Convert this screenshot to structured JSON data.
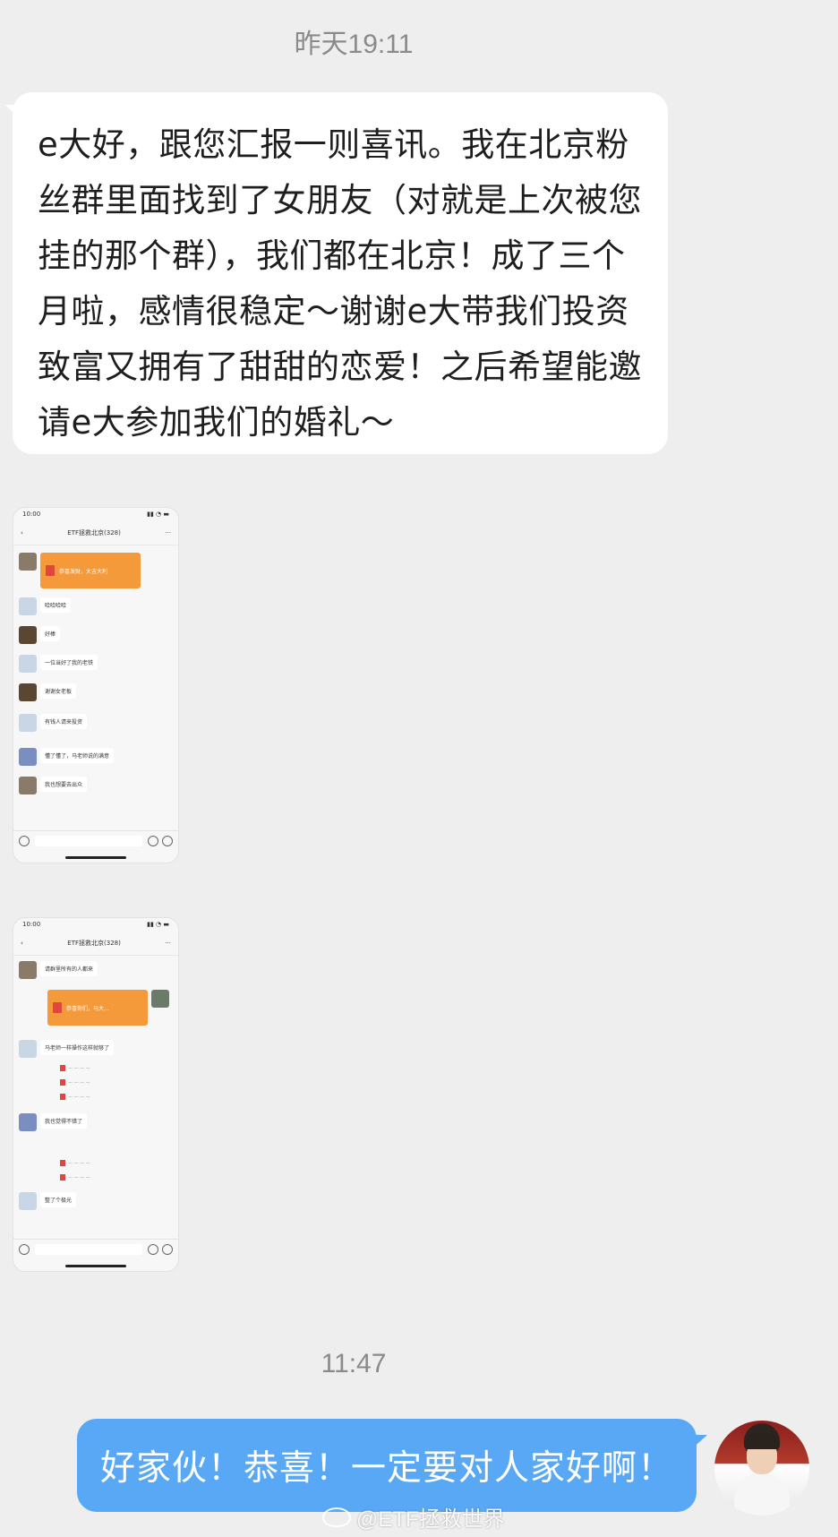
{
  "chat": {
    "timestamp_1": "昨天19:11",
    "incoming_message": "e大好，跟您汇报一则喜讯。我在北京粉丝群里面找到了女朋友（对就是上次被您挂的那个群），我们都在北京！成了三个月啦，感情很稳定～谢谢e大带我们投资致富又拥有了甜甜的恋爱！之后希望能邀请e大参加我们的婚礼～",
    "timestamp_2": "11:47",
    "outgoing_message": "好家伙！恭喜！一定要对人家好啊！"
  },
  "screenshot_1": {
    "status_time": "10:00",
    "group_title": "ETF拯救北京(328)",
    "messages": [
      {
        "type": "red_packet",
        "label": "恭喜发财，大吉大利"
      },
      {
        "type": "text",
        "text": "哈哈哈哈"
      },
      {
        "type": "text",
        "text": "好棒"
      },
      {
        "type": "text",
        "text": "一位当好了我的老铁"
      },
      {
        "type": "text",
        "text": "谢谢女老板"
      },
      {
        "type": "text",
        "text": "有钱人请来投资"
      },
      {
        "type": "text",
        "text": "懂了懂了，马老师说的满意"
      },
      {
        "type": "text",
        "text": "我也想要去出众"
      }
    ]
  },
  "screenshot_2": {
    "status_time": "10:00",
    "group_title": "ETF拯救北京(328)",
    "messages": [
      {
        "type": "text",
        "text": "请群里所有的人都来"
      },
      {
        "type": "red_packet",
        "label": "恭喜你们，马大..."
      },
      {
        "type": "text",
        "text": "马老师一样操作这样就够了"
      },
      {
        "type": "text",
        "text": "我也觉得不错了"
      },
      {
        "type": "text",
        "text": "整了个极光"
      }
    ]
  },
  "watermark": {
    "text": "@ETF拯救世界"
  }
}
